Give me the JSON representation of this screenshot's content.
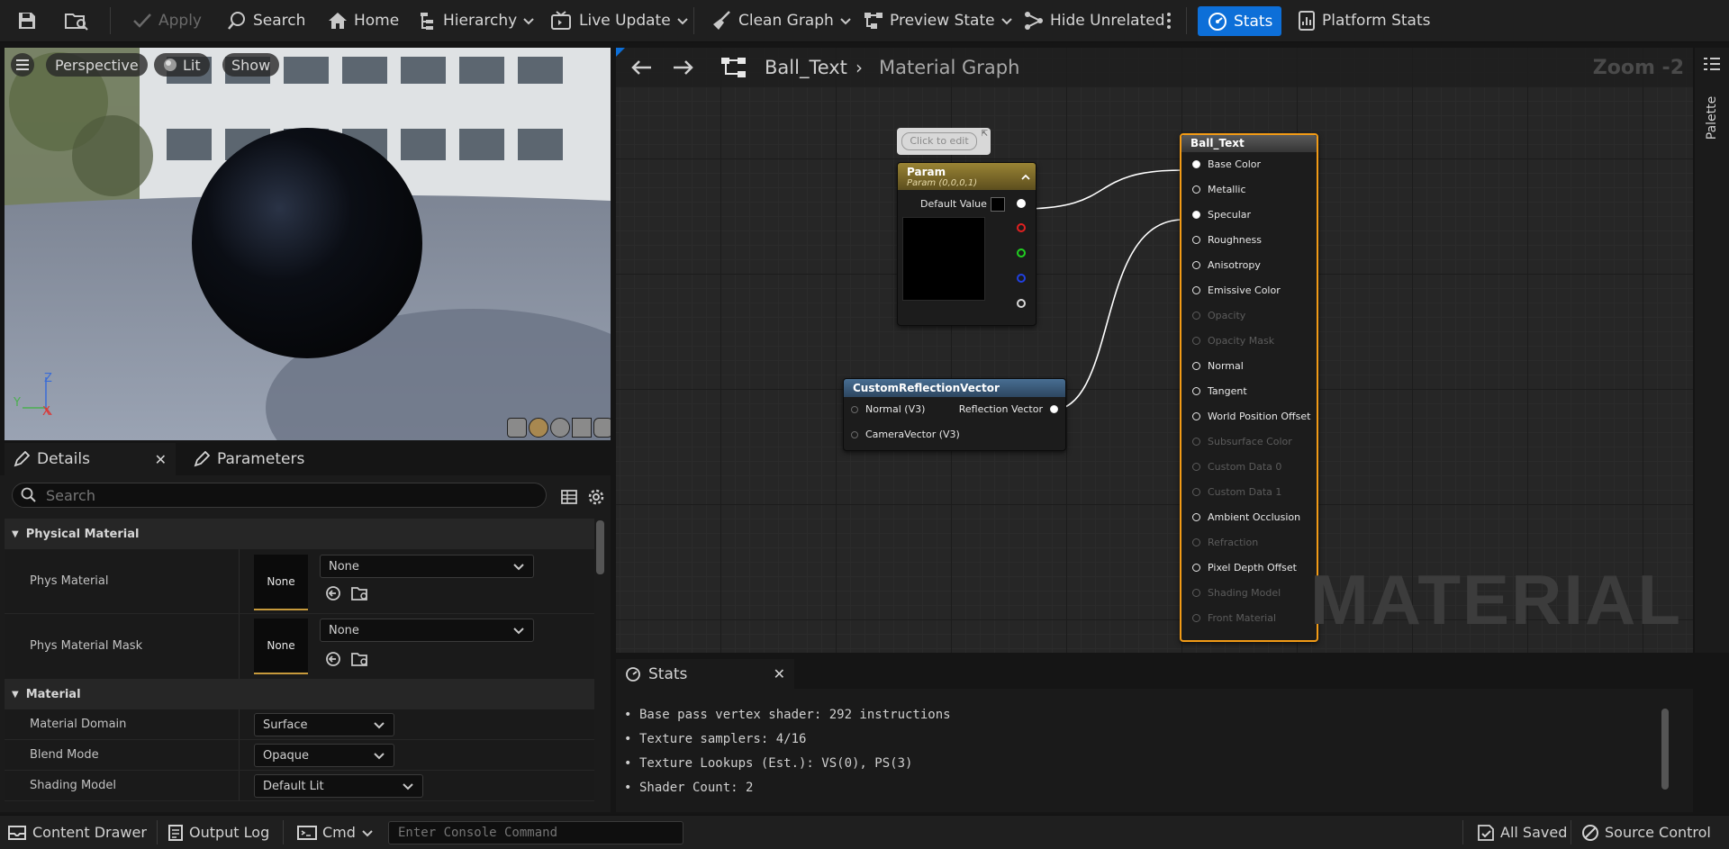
{
  "toolbar": {
    "apply": "Apply",
    "search": "Search",
    "home": "Home",
    "hierarchy": "Hierarchy",
    "live_update": "Live Update",
    "clean_graph": "Clean Graph",
    "preview_state": "Preview State",
    "hide_unrelated": "Hide Unrelated",
    "stats": "Stats",
    "platform_stats": "Platform Stats"
  },
  "viewport": {
    "perspective": "Perspective",
    "lit": "Lit",
    "show": "Show",
    "axes": {
      "z": "Z",
      "y": "Y",
      "x": "X"
    }
  },
  "details": {
    "tab_details": "Details",
    "tab_parameters": "Parameters",
    "search_placeholder": "Search",
    "categories": {
      "physical_material": "Physical Material",
      "material": "Material"
    },
    "phys_material": {
      "label": "Phys Material",
      "thumb": "None",
      "value": "None"
    },
    "phys_material_mask": {
      "label": "Phys Material Mask",
      "thumb": "None",
      "value": "None"
    },
    "material_domain": {
      "label": "Material Domain",
      "value": "Surface"
    },
    "blend_mode": {
      "label": "Blend Mode",
      "value": "Opaque"
    },
    "shading_model": {
      "label": "Shading Model",
      "value": "Default Lit"
    }
  },
  "graph": {
    "breadcrumb_asset": "Ball_Text",
    "breadcrumb_graph": "Material Graph",
    "zoom": "Zoom -2",
    "watermark": "MATERIAL",
    "palette": "Palette",
    "comment_bubble": "Click to edit",
    "param_node": {
      "title": "Param",
      "subtitle": "Param (0,0,0,1)",
      "default_value": "Default Value"
    },
    "crv_node": {
      "title": "CustomReflectionVector",
      "inputs": [
        "Normal (V3)",
        "CameraVector (V3)"
      ],
      "output": "Reflection Vector"
    },
    "result_node": {
      "title": "Ball_Text",
      "pins": [
        {
          "label": "Base Color",
          "enabled": true,
          "connected": true
        },
        {
          "label": "Metallic",
          "enabled": true,
          "connected": false
        },
        {
          "label": "Specular",
          "enabled": true,
          "connected": true
        },
        {
          "label": "Roughness",
          "enabled": true,
          "connected": false
        },
        {
          "label": "Anisotropy",
          "enabled": true,
          "connected": false
        },
        {
          "label": "Emissive Color",
          "enabled": true,
          "connected": false
        },
        {
          "label": "Opacity",
          "enabled": false,
          "connected": false
        },
        {
          "label": "Opacity Mask",
          "enabled": false,
          "connected": false
        },
        {
          "label": "Normal",
          "enabled": true,
          "connected": false
        },
        {
          "label": "Tangent",
          "enabled": true,
          "connected": false
        },
        {
          "label": "World Position Offset",
          "enabled": true,
          "connected": false
        },
        {
          "label": "Subsurface Color",
          "enabled": false,
          "connected": false
        },
        {
          "label": "Custom Data 0",
          "enabled": false,
          "connected": false
        },
        {
          "label": "Custom Data 1",
          "enabled": false,
          "connected": false
        },
        {
          "label": "Ambient Occlusion",
          "enabled": true,
          "connected": false
        },
        {
          "label": "Refraction",
          "enabled": false,
          "connected": false
        },
        {
          "label": "Pixel Depth Offset",
          "enabled": true,
          "connected": false
        },
        {
          "label": "Shading Model",
          "enabled": false,
          "connected": false
        },
        {
          "label": "Front Material",
          "enabled": false,
          "connected": false
        }
      ]
    }
  },
  "stats": {
    "tab": "Stats",
    "lines": [
      "Base pass vertex shader: 292 instructions",
      "Texture samplers: 4/16",
      "Texture Lookups (Est.): VS(0), PS(3)",
      "Shader Count: 2"
    ]
  },
  "bottombar": {
    "content_drawer": "Content Drawer",
    "output_log": "Output Log",
    "cmd": "Cmd",
    "console_placeholder": "Enter Console Command",
    "all_saved": "All Saved",
    "source_control": "Source Control"
  },
  "colors": {
    "accent": "#0d6fd8",
    "selection": "#f29b16",
    "param_header": "#8a7428",
    "crv_header": "#3a5b7a",
    "result_header": "#4a4a4a"
  }
}
